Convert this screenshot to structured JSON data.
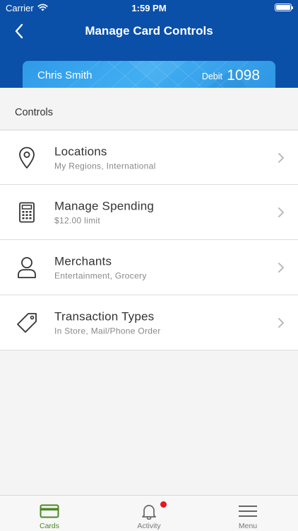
{
  "status_bar": {
    "carrier": "Carrier",
    "time": "1:59 PM",
    "wifi_icon": "wifi-icon",
    "battery_icon": "battery-icon"
  },
  "nav": {
    "title": "Manage Card Controls",
    "back_icon": "chevron-left-icon"
  },
  "card": {
    "holder": "Chris Smith",
    "type": "Debit",
    "last4": "1098"
  },
  "controls": {
    "header": "Controls",
    "items": [
      {
        "icon": "location-pin-icon",
        "label": "Locations",
        "detail": "My Regions, International"
      },
      {
        "icon": "calculator-icon",
        "label": "Manage Spending",
        "detail": "$12.00 limit"
      },
      {
        "icon": "person-icon",
        "label": "Merchants",
        "detail": "Entertainment, Grocery"
      },
      {
        "icon": "tag-icon",
        "label": "Transaction Types",
        "detail": "In Store, Mail/Phone Order"
      }
    ]
  },
  "tab_bar": {
    "tabs": [
      {
        "label": "Cards",
        "icon": "card-icon",
        "active": true
      },
      {
        "label": "Activity",
        "icon": "bell-icon",
        "active": false
      },
      {
        "label": "Menu",
        "icon": "hamburger-icon",
        "active": false
      }
    ]
  },
  "colors": {
    "brand_blue": "#0b50a8",
    "card_blue": "#3aa5ee",
    "active_tab_green": "#4a8a22",
    "notification_red": "#e8141e"
  }
}
